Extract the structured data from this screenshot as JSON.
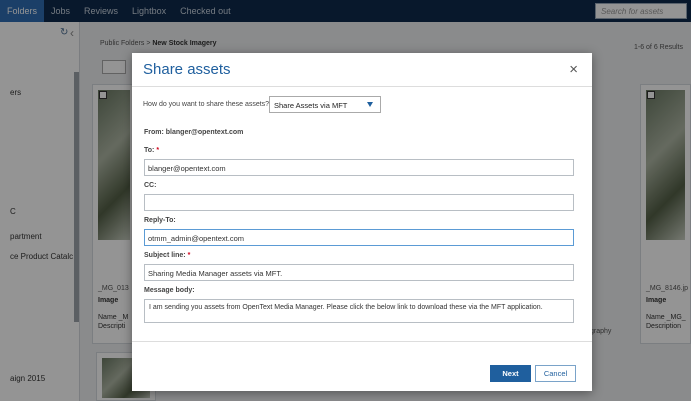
{
  "nav": {
    "tabs": [
      "Folders",
      "Jobs",
      "Reviews",
      "Lightbox",
      "Checked out"
    ],
    "search_placeholder": "Search for assets"
  },
  "sidebar": {
    "items": [
      "ers",
      "C",
      "partment",
      "ce Product Catalc",
      "aign 2015"
    ]
  },
  "content": {
    "breadcrumb_root": "Public Folders",
    "breadcrumb_sep": ">",
    "breadcrumb_current": "New Stock Imagery",
    "results": "1-6 of 6 Results",
    "cards": [
      {
        "fname": "_MG_013",
        "img": "Image",
        "meta1": "Name _M",
        "meta2": "Descripti"
      },
      {
        "fname": "_MG_8146.jp",
        "img": "Image",
        "meta1": "Name _MG_",
        "meta2": "Description"
      }
    ],
    "partial_text": "graphy"
  },
  "modal": {
    "title": "Share assets",
    "close": "×",
    "question": "How do you want to share these assets?",
    "share_method": "Share Assets via MFT",
    "from": "From: blanger@opentext.com",
    "to_label": "To:",
    "to_value": "blanger@opentext.com",
    "cc_label": "CC:",
    "cc_value": "",
    "reply_label": "Reply-To:",
    "reply_value": "otmm_admin@opentext.com",
    "subject_label": "Subject line:",
    "subject_value": "Sharing Media Manager assets via MFT.",
    "message_label": "Message body:",
    "message_value": "I am sending you assets from OpenText Media Manager. Please click the below link to download these via the MFT application.",
    "required_mark": "*",
    "next_label": "Next",
    "cancel_label": "Cancel"
  },
  "colors": {
    "nav_bg": "#0e2a4d",
    "nav_active": "#2f6db3",
    "accent": "#1f5f9e",
    "required": "#d0021b"
  }
}
